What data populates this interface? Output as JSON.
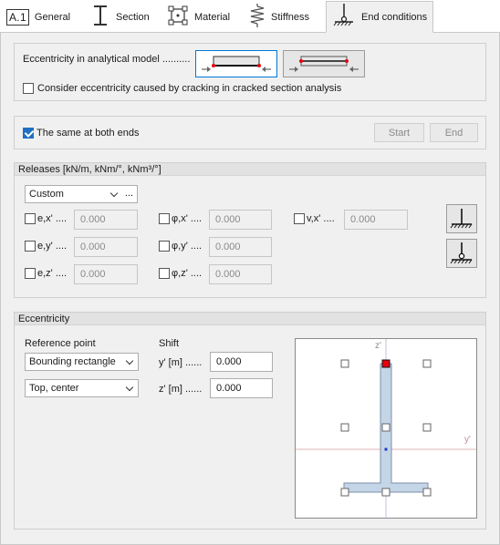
{
  "tabs": [
    {
      "label": "General",
      "badge": "A.1"
    },
    {
      "label": "Section"
    },
    {
      "label": "Material"
    },
    {
      "label": "Stiffness"
    },
    {
      "label": "End conditions"
    }
  ],
  "eccentricity_model": {
    "label": "Eccentricity in analytical model ..........",
    "crack_label": "Consider eccentricity caused by cracking in cracked section analysis",
    "crack_checked": false
  },
  "ends": {
    "same_label": "The same at both ends",
    "same_checked": true,
    "start_label": "Start",
    "end_label": "End"
  },
  "releases": {
    "title": "Releases [kN/m, kNm/°, kNm³/°]",
    "preset": "Custom",
    "more": "...",
    "fields": [
      {
        "label": "e,x' ....",
        "value": "0.000"
      },
      {
        "label": "φ,x' ....",
        "value": "0.000"
      },
      {
        "label": "v,x' ....",
        "value": "0.000"
      },
      {
        "label": "e,y' ....",
        "value": "0.000"
      },
      {
        "label": "φ,y' ....",
        "value": "0.000"
      },
      {
        "label": "e,z' ....",
        "value": "0.000"
      },
      {
        "label": "φ,z' ....",
        "value": "0.000"
      }
    ]
  },
  "eccentricity": {
    "title": "Eccentricity",
    "ref_label": "Reference point",
    "ref_option": "Bounding rectangle",
    "pos_option": "Top, center",
    "shift_label": "Shift",
    "y_label": "y' [m] ......",
    "y_value": "0.000",
    "z_label": "z' [m] ......",
    "z_value": "0.000",
    "axis_z": "z'",
    "axis_y": "y'"
  },
  "colors": {
    "accent": "#0078d7",
    "check": "#1f6fc2",
    "section_fill": "#c5d5e8",
    "marker": "#e8000f"
  }
}
